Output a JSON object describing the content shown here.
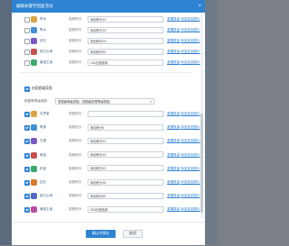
{
  "dialog": {
    "title": "编辑关键字回复活动",
    "close": "×"
  },
  "top_list": [
    {
      "name": "青水",
      "type": "奖励积分",
      "value": "添加积分10",
      "link1": "重置数量",
      "link2": "添加奖品图片"
    },
    {
      "name": "黑水",
      "type": "奖励积分",
      "value": "添加积分15",
      "link1": "重置数量",
      "link2": "添加奖品图片"
    },
    {
      "name": "钻石",
      "type": "奖励积分",
      "value": "添加积分25",
      "link1": "重置数量",
      "link2": "添加奖品图片"
    },
    {
      "name": "超凡大师",
      "type": "奖励积分",
      "value": "添加积分50",
      "link1": "重置数量",
      "link2": "添加奖品图片"
    },
    {
      "name": "最强王者",
      "type": "奖励积分",
      "value": "100元鼓励券",
      "link1": "重置数量",
      "link2": "添加奖品图片"
    }
  ],
  "section": {
    "label": "启用超级奖励"
  },
  "filter": {
    "label": "按星等等级奖励",
    "value": "按超级等级奖励，按超级权限等级奖励"
  },
  "bottom_list": [
    {
      "name": "无梦者",
      "type": "奖励积分",
      "value": "",
      "link1": "重置数量",
      "link2": "添加奖品图片"
    },
    {
      "name": "黑铜",
      "type": "奖励积分",
      "value": "添加积分5",
      "link1": "重置数量",
      "link2": "添加奖品图片"
    },
    {
      "name": "白银",
      "type": "奖励积分",
      "value": "添加积分10",
      "link1": "重置数量",
      "link2": "添加奖品图片"
    },
    {
      "name": "黄金",
      "type": "奖励积分",
      "value": "添加积分15",
      "link1": "重置数量",
      "link2": "添加奖品图片"
    },
    {
      "name": "铂金",
      "type": "奖励积分",
      "value": "添加积分20",
      "link1": "重置数量",
      "link2": "添加奖品图片"
    },
    {
      "name": "钻石",
      "type": "奖励积分",
      "value": "添加积分25",
      "link1": "重置数量",
      "link2": "添加奖品图片"
    },
    {
      "name": "超凡大师",
      "type": "奖励积分",
      "value": "添加积分50",
      "link1": "重置数量",
      "link2": "添加奖品图片"
    },
    {
      "name": "最强王者",
      "type": "奖励积分",
      "value": "200元鼓励券",
      "link1": "重置数量",
      "link2": "添加奖品图片"
    }
  ],
  "footer": {
    "save": "确认并保存",
    "cancel": "取消"
  },
  "colors": {
    "accent": "#2e83d3",
    "titlebar": "#2e83d3"
  },
  "icons": [
    "close-icon",
    "checkbox-icon",
    "rank-badge-icon",
    "caret-down-icon"
  ]
}
